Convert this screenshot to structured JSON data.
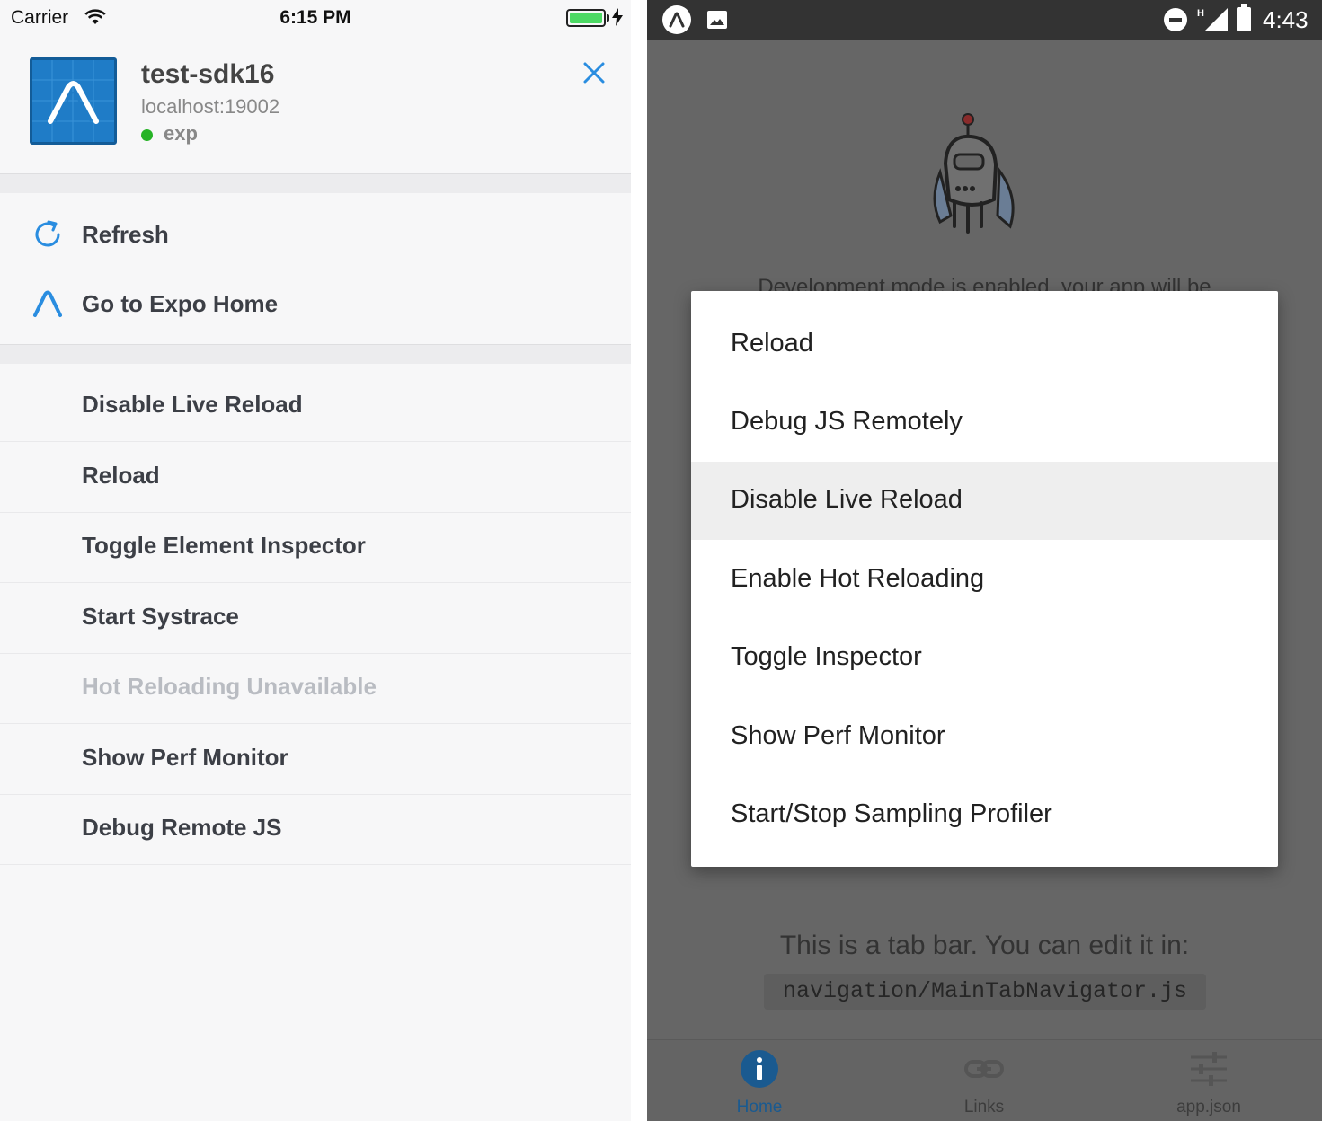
{
  "ios": {
    "status_bar": {
      "carrier": "Carrier",
      "time": "6:15 PM",
      "battery_color": "#4cd964"
    },
    "project": {
      "name": "test-sdk16",
      "host": "localhost:19002",
      "status": "exp",
      "status_dot_color": "#26b326",
      "icon": "expo-logo-icon"
    },
    "actions": [
      {
        "label": "Refresh",
        "icon": "refresh-icon"
      },
      {
        "label": "Go to Expo Home",
        "icon": "expo-home-icon"
      }
    ],
    "dev_menu": [
      {
        "label": "Disable Live Reload",
        "enabled": true
      },
      {
        "label": "Reload",
        "enabled": true
      },
      {
        "label": "Toggle Element Inspector",
        "enabled": true
      },
      {
        "label": "Start Systrace",
        "enabled": true
      },
      {
        "label": "Hot Reloading Unavailable",
        "enabled": false
      },
      {
        "label": "Show Perf Monitor",
        "enabled": true
      },
      {
        "label": "Debug Remote JS",
        "enabled": true
      }
    ],
    "accent_color": "#1f7cc7"
  },
  "android": {
    "status_bar": {
      "time": "4:43",
      "network": "H"
    },
    "background": {
      "dev_mode_text": "Development mode is enabled, your app will be",
      "tab_bar_text": "This is a tab bar. You can edit it in:",
      "code_path": "navigation/MainTabNavigator.js"
    },
    "dev_dialog": {
      "items": [
        {
          "label": "Reload",
          "selected": false
        },
        {
          "label": "Debug JS Remotely",
          "selected": false
        },
        {
          "label": "Disable Live Reload",
          "selected": true
        },
        {
          "label": "Enable Hot Reloading",
          "selected": false
        },
        {
          "label": "Toggle Inspector",
          "selected": false
        },
        {
          "label": "Show Perf Monitor",
          "selected": false
        },
        {
          "label": "Start/Stop Sampling Profiler",
          "selected": false
        }
      ]
    },
    "tabs": [
      {
        "label": "Home",
        "icon": "info-icon",
        "active": true
      },
      {
        "label": "Links",
        "icon": "link-icon",
        "active": false
      },
      {
        "label": "app.json",
        "icon": "sliders-icon",
        "active": false
      }
    ],
    "active_tab_color": "#1a5a90"
  }
}
